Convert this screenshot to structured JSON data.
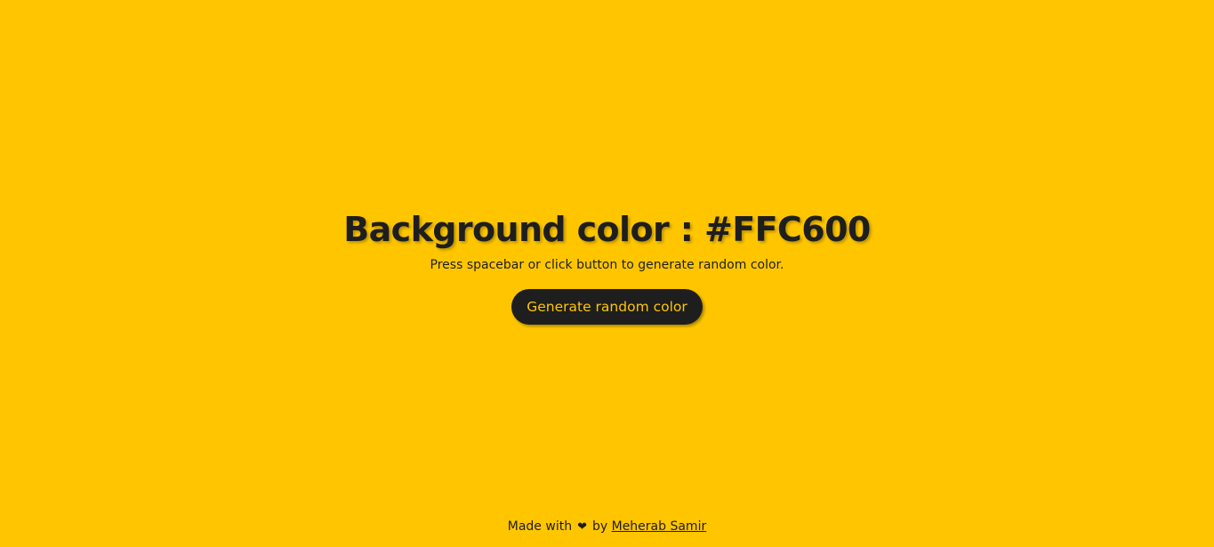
{
  "colors": {
    "background": "#FFC600",
    "text": "#1e1e1e",
    "button_background": "#1e1e1e",
    "button_text": "#FFC600"
  },
  "main": {
    "title": "Background color : #FFC600",
    "subtitle": "Press spacebar or click button to generate random color.",
    "button_label": "Generate random color"
  },
  "footer": {
    "prefix": "Made with",
    "heart_icon": "heart-icon",
    "heart_glyph": "❤",
    "by_text": "by",
    "author_link": "Meherab Samir"
  }
}
